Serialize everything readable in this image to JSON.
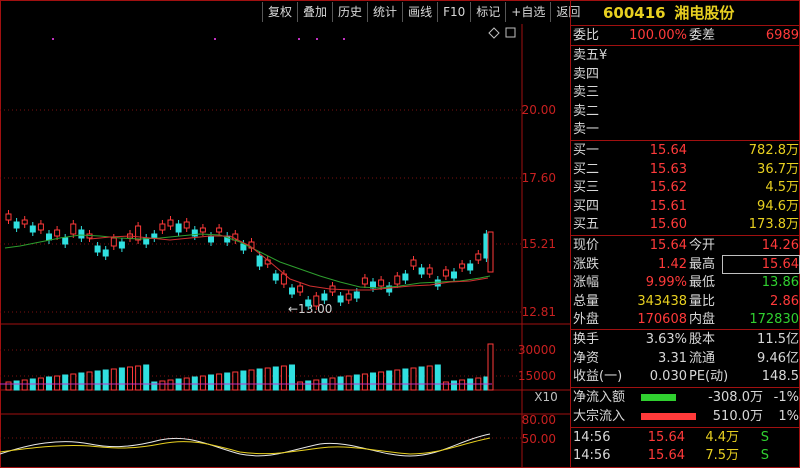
{
  "toolbar": {
    "items": [
      "复权",
      "叠加",
      "历史",
      "统计",
      "画线",
      "F10",
      "标记",
      "+自选",
      "返回"
    ]
  },
  "stock": {
    "code": "600416",
    "name": "湘电股份"
  },
  "ratio": {
    "label1": "委比",
    "value1": "100.00%",
    "label2": "委差",
    "value2": "6989"
  },
  "asks": [
    {
      "label": "卖五",
      "price": "¥"
    },
    {
      "label": "卖四",
      "price": ""
    },
    {
      "label": "卖三",
      "price": ""
    },
    {
      "label": "卖二",
      "price": ""
    },
    {
      "label": "卖一",
      "price": ""
    }
  ],
  "bids": [
    {
      "label": "买一",
      "price": "15.64",
      "vol": "782.8万"
    },
    {
      "label": "买二",
      "price": "15.63",
      "vol": "36.7万"
    },
    {
      "label": "买三",
      "price": "15.62",
      "vol": "4.5万"
    },
    {
      "label": "买四",
      "price": "15.61",
      "vol": "94.6万"
    },
    {
      "label": "买五",
      "price": "15.60",
      "vol": "173.8万"
    }
  ],
  "quote": [
    {
      "l1": "现价",
      "v1": "15.64",
      "l2": "今开",
      "v2": "14.26"
    },
    {
      "l1": "涨跌",
      "v1": "1.42",
      "l2": "最高",
      "v2": "15.64"
    },
    {
      "l1": "涨幅",
      "v1": "9.99%",
      "l2": "最低",
      "v2": "13.86"
    },
    {
      "l1": "总量",
      "v1": "343438",
      "l2": "量比",
      "v2": "2.86"
    },
    {
      "l1": "外盘",
      "v1": "170608",
      "l2": "内盘",
      "v2": "172830"
    }
  ],
  "fund": [
    {
      "l1": "换手",
      "v1": "3.63%",
      "l2": "股本",
      "v2": "11.5亿"
    },
    {
      "l1": "净资",
      "v1": "3.31",
      "l2": "流通",
      "v2": "9.46亿"
    },
    {
      "l1": "收益(一)",
      "v1": "0.030",
      "l2": "PE(动)",
      "v2": "148.5"
    }
  ],
  "flow": [
    {
      "label": "净流入额",
      "value": "-308.0万",
      "pct": "-1%",
      "color": "#30d030",
      "ratio": 0.35
    },
    {
      "label": "大宗流入",
      "value": "510.0万",
      "pct": "1%",
      "color": "#ff3a3a",
      "ratio": 0.55
    }
  ],
  "ticks": [
    {
      "time": "14:56",
      "price": "15.64",
      "vol": "4.4万",
      "side": "S"
    },
    {
      "time": "14:56",
      "price": "15.64",
      "vol": "7.5万",
      "side": "S"
    }
  ],
  "chart": {
    "price_labels": [
      "20.00",
      "17.60",
      "15.21",
      "12.81"
    ],
    "min_annotation": "←13.00",
    "vol_labels": [
      "30000",
      "15000",
      "X10"
    ],
    "ind_labels": [
      "80.00",
      "50.00"
    ]
  }
}
